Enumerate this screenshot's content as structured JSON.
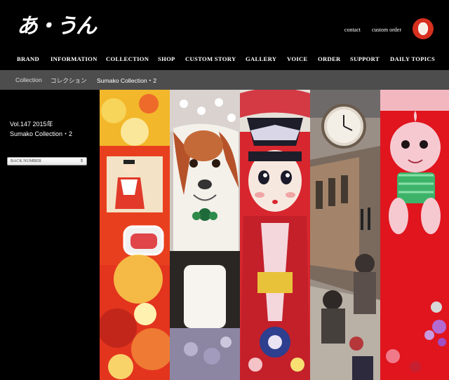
{
  "header": {
    "logo_text": "あ・うん",
    "links": {
      "contact": "contact",
      "custom_order": "custom order"
    },
    "badge_icon": "kewpie-face-icon"
  },
  "nav": {
    "items": [
      "BRAND",
      "INFORMATION",
      "COLLECTION",
      "SHOP",
      "CUSTOM STORY",
      "GALLERY",
      "VOICE",
      "ORDER",
      "SUPPORT",
      "DAILY TOPICS"
    ]
  },
  "breadcrumb": {
    "items": [
      "Collection",
      "コレクション",
      "Sumako Collection・2"
    ]
  },
  "sidebar": {
    "vol_line": "Vol.147  2015年",
    "title_line": "Sumako Collection・2",
    "select_value": "BACK NUMBER"
  },
  "colors": {
    "background": "#000000",
    "breadcrumb_bar": "#4d4d4d",
    "badge": "#d7301f"
  }
}
